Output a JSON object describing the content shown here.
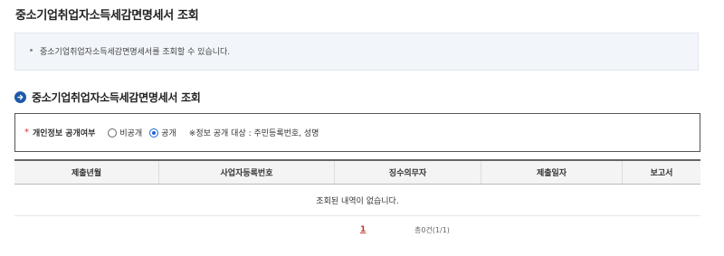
{
  "page": {
    "title": "중소기업취업자소득세감면명세서 조회"
  },
  "info": {
    "message": "중소기업취업자소득세감면명세서를 조회할 수 있습니다."
  },
  "section": {
    "title": "중소기업취업자소득세감면명세서 조회",
    "icon": "arrow-right-circle-icon"
  },
  "filter": {
    "required_mark": "*",
    "label": "개인정보 공개여부",
    "options": [
      {
        "label": "비공개",
        "checked": false
      },
      {
        "label": "공개",
        "checked": true
      }
    ],
    "note": "※정보 공개 대상 : 주민등록번호, 성명"
  },
  "table": {
    "columns": [
      "제출년월",
      "사업자등록번호",
      "징수의무자",
      "제출일자",
      "보고서"
    ],
    "empty_message": "조회된 내역이 없습니다."
  },
  "pagination": {
    "current_page": "1",
    "total_text": "총0건(1/1)"
  },
  "colors": {
    "accent": "#1e5aa8",
    "required": "#d33333",
    "page_link": "#c0392b"
  }
}
